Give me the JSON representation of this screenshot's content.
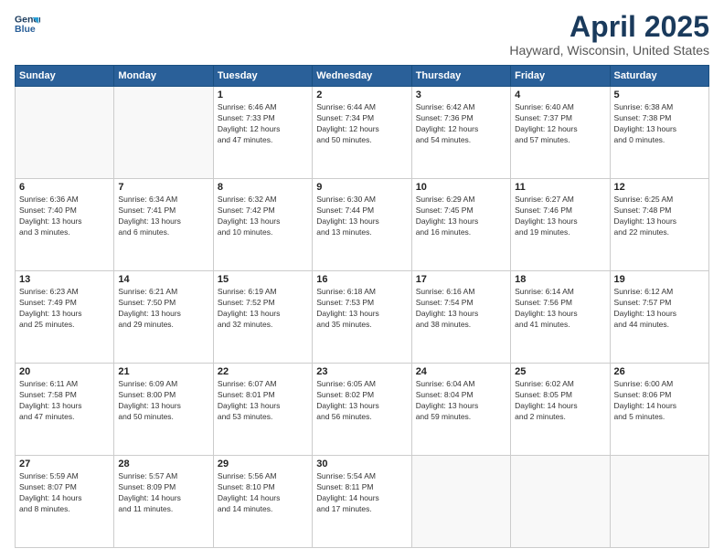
{
  "header": {
    "logo_line1": "General",
    "logo_line2": "Blue",
    "title": "April 2025",
    "subtitle": "Hayward, Wisconsin, United States"
  },
  "days_of_week": [
    "Sunday",
    "Monday",
    "Tuesday",
    "Wednesday",
    "Thursday",
    "Friday",
    "Saturday"
  ],
  "weeks": [
    [
      {
        "day": "",
        "info": ""
      },
      {
        "day": "",
        "info": ""
      },
      {
        "day": "1",
        "info": "Sunrise: 6:46 AM\nSunset: 7:33 PM\nDaylight: 12 hours\nand 47 minutes."
      },
      {
        "day": "2",
        "info": "Sunrise: 6:44 AM\nSunset: 7:34 PM\nDaylight: 12 hours\nand 50 minutes."
      },
      {
        "day": "3",
        "info": "Sunrise: 6:42 AM\nSunset: 7:36 PM\nDaylight: 12 hours\nand 54 minutes."
      },
      {
        "day": "4",
        "info": "Sunrise: 6:40 AM\nSunset: 7:37 PM\nDaylight: 12 hours\nand 57 minutes."
      },
      {
        "day": "5",
        "info": "Sunrise: 6:38 AM\nSunset: 7:38 PM\nDaylight: 13 hours\nand 0 minutes."
      }
    ],
    [
      {
        "day": "6",
        "info": "Sunrise: 6:36 AM\nSunset: 7:40 PM\nDaylight: 13 hours\nand 3 minutes."
      },
      {
        "day": "7",
        "info": "Sunrise: 6:34 AM\nSunset: 7:41 PM\nDaylight: 13 hours\nand 6 minutes."
      },
      {
        "day": "8",
        "info": "Sunrise: 6:32 AM\nSunset: 7:42 PM\nDaylight: 13 hours\nand 10 minutes."
      },
      {
        "day": "9",
        "info": "Sunrise: 6:30 AM\nSunset: 7:44 PM\nDaylight: 13 hours\nand 13 minutes."
      },
      {
        "day": "10",
        "info": "Sunrise: 6:29 AM\nSunset: 7:45 PM\nDaylight: 13 hours\nand 16 minutes."
      },
      {
        "day": "11",
        "info": "Sunrise: 6:27 AM\nSunset: 7:46 PM\nDaylight: 13 hours\nand 19 minutes."
      },
      {
        "day": "12",
        "info": "Sunrise: 6:25 AM\nSunset: 7:48 PM\nDaylight: 13 hours\nand 22 minutes."
      }
    ],
    [
      {
        "day": "13",
        "info": "Sunrise: 6:23 AM\nSunset: 7:49 PM\nDaylight: 13 hours\nand 25 minutes."
      },
      {
        "day": "14",
        "info": "Sunrise: 6:21 AM\nSunset: 7:50 PM\nDaylight: 13 hours\nand 29 minutes."
      },
      {
        "day": "15",
        "info": "Sunrise: 6:19 AM\nSunset: 7:52 PM\nDaylight: 13 hours\nand 32 minutes."
      },
      {
        "day": "16",
        "info": "Sunrise: 6:18 AM\nSunset: 7:53 PM\nDaylight: 13 hours\nand 35 minutes."
      },
      {
        "day": "17",
        "info": "Sunrise: 6:16 AM\nSunset: 7:54 PM\nDaylight: 13 hours\nand 38 minutes."
      },
      {
        "day": "18",
        "info": "Sunrise: 6:14 AM\nSunset: 7:56 PM\nDaylight: 13 hours\nand 41 minutes."
      },
      {
        "day": "19",
        "info": "Sunrise: 6:12 AM\nSunset: 7:57 PM\nDaylight: 13 hours\nand 44 minutes."
      }
    ],
    [
      {
        "day": "20",
        "info": "Sunrise: 6:11 AM\nSunset: 7:58 PM\nDaylight: 13 hours\nand 47 minutes."
      },
      {
        "day": "21",
        "info": "Sunrise: 6:09 AM\nSunset: 8:00 PM\nDaylight: 13 hours\nand 50 minutes."
      },
      {
        "day": "22",
        "info": "Sunrise: 6:07 AM\nSunset: 8:01 PM\nDaylight: 13 hours\nand 53 minutes."
      },
      {
        "day": "23",
        "info": "Sunrise: 6:05 AM\nSunset: 8:02 PM\nDaylight: 13 hours\nand 56 minutes."
      },
      {
        "day": "24",
        "info": "Sunrise: 6:04 AM\nSunset: 8:04 PM\nDaylight: 13 hours\nand 59 minutes."
      },
      {
        "day": "25",
        "info": "Sunrise: 6:02 AM\nSunset: 8:05 PM\nDaylight: 14 hours\nand 2 minutes."
      },
      {
        "day": "26",
        "info": "Sunrise: 6:00 AM\nSunset: 8:06 PM\nDaylight: 14 hours\nand 5 minutes."
      }
    ],
    [
      {
        "day": "27",
        "info": "Sunrise: 5:59 AM\nSunset: 8:07 PM\nDaylight: 14 hours\nand 8 minutes."
      },
      {
        "day": "28",
        "info": "Sunrise: 5:57 AM\nSunset: 8:09 PM\nDaylight: 14 hours\nand 11 minutes."
      },
      {
        "day": "29",
        "info": "Sunrise: 5:56 AM\nSunset: 8:10 PM\nDaylight: 14 hours\nand 14 minutes."
      },
      {
        "day": "30",
        "info": "Sunrise: 5:54 AM\nSunset: 8:11 PM\nDaylight: 14 hours\nand 17 minutes."
      },
      {
        "day": "",
        "info": ""
      },
      {
        "day": "",
        "info": ""
      },
      {
        "day": "",
        "info": ""
      }
    ]
  ]
}
